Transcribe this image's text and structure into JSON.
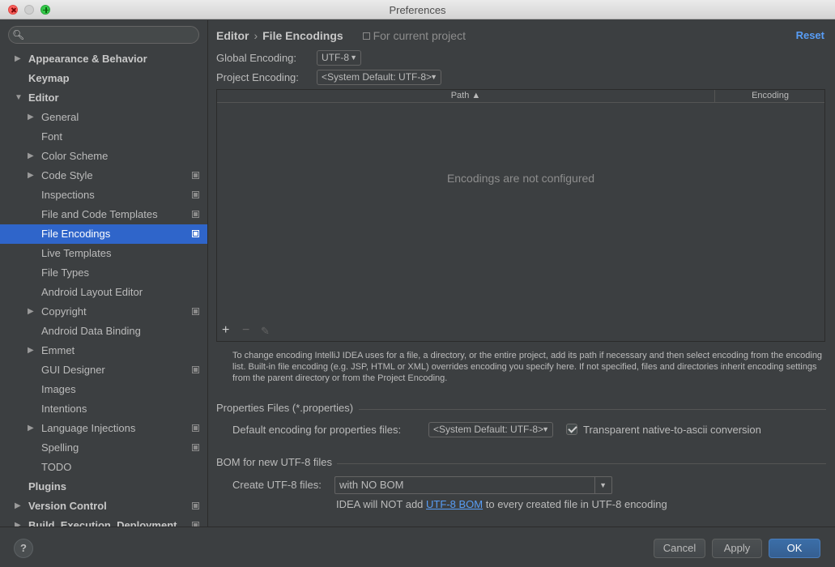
{
  "window": {
    "title": "Preferences"
  },
  "sidebar": {
    "search_placeholder": "",
    "items": [
      {
        "label": "Appearance & Behavior",
        "level": 0,
        "arrow": "▶",
        "bold": true
      },
      {
        "label": "Keymap",
        "level": 0,
        "arrow": "",
        "bold": true
      },
      {
        "label": "Editor",
        "level": 0,
        "arrow": "▼",
        "bold": true
      },
      {
        "label": "General",
        "level": 1,
        "arrow": "▶"
      },
      {
        "label": "Font",
        "level": 1,
        "arrow": ""
      },
      {
        "label": "Color Scheme",
        "level": 1,
        "arrow": "▶"
      },
      {
        "label": "Code Style",
        "level": 1,
        "arrow": "▶",
        "project": true
      },
      {
        "label": "Inspections",
        "level": 1,
        "arrow": "",
        "project": true
      },
      {
        "label": "File and Code Templates",
        "level": 1,
        "arrow": "",
        "project": true
      },
      {
        "label": "File Encodings",
        "level": 1,
        "arrow": "",
        "project": true,
        "selected": true
      },
      {
        "label": "Live Templates",
        "level": 1,
        "arrow": ""
      },
      {
        "label": "File Types",
        "level": 1,
        "arrow": ""
      },
      {
        "label": "Android Layout Editor",
        "level": 1,
        "arrow": ""
      },
      {
        "label": "Copyright",
        "level": 1,
        "arrow": "▶",
        "project": true
      },
      {
        "label": "Android Data Binding",
        "level": 1,
        "arrow": ""
      },
      {
        "label": "Emmet",
        "level": 1,
        "arrow": "▶"
      },
      {
        "label": "GUI Designer",
        "level": 1,
        "arrow": "",
        "project": true
      },
      {
        "label": "Images",
        "level": 1,
        "arrow": ""
      },
      {
        "label": "Intentions",
        "level": 1,
        "arrow": ""
      },
      {
        "label": "Language Injections",
        "level": 1,
        "arrow": "▶",
        "project": true
      },
      {
        "label": "Spelling",
        "level": 1,
        "arrow": "",
        "project": true
      },
      {
        "label": "TODO",
        "level": 1,
        "arrow": ""
      },
      {
        "label": "Plugins",
        "level": 0,
        "arrow": "",
        "bold": true
      },
      {
        "label": "Version Control",
        "level": 0,
        "arrow": "▶",
        "bold": true,
        "project": true
      },
      {
        "label": "Build, Execution, Deployment",
        "level": 0,
        "arrow": "▶",
        "bold": true,
        "project": true
      }
    ]
  },
  "breadcrumb": {
    "parent": "Editor",
    "separator": "›",
    "current": "File Encodings",
    "scope": "For current project"
  },
  "reset_label": "Reset",
  "global_encoding": {
    "label": "Global Encoding:",
    "value": "UTF-8"
  },
  "project_encoding": {
    "label": "Project Encoding:",
    "value": "<System Default: UTF-8>"
  },
  "table": {
    "columns": [
      "Path ▲",
      "Encoding"
    ],
    "empty_text": "Encodings are not configured",
    "toolbar": {
      "add": "+",
      "remove": "−",
      "edit": "✎"
    }
  },
  "help_text": "To change encoding IntelliJ IDEA uses for a file, a directory, or the entire project, add its path if necessary and then select encoding from the encoding list. Built-in file encoding (e.g. JSP, HTML or XML) overrides encoding you specify here. If not specified, files and directories inherit encoding settings from the parent directory or from the Project Encoding.",
  "properties_section": {
    "title": "Properties Files (*.properties)",
    "default_label": "Default encoding for properties files:",
    "default_value": "<System Default: UTF-8>",
    "transparent_label": "Transparent native-to-ascii conversion",
    "transparent_checked": true
  },
  "bom_section": {
    "title": "BOM for new UTF-8 files",
    "create_label": "Create UTF-8 files:",
    "create_value": "with NO BOM",
    "note_prefix": "IDEA will NOT add",
    "note_link": "UTF-8 BOM",
    "note_suffix": "to every created file in UTF-8 encoding"
  },
  "footer": {
    "help": "?",
    "cancel": "Cancel",
    "apply": "Apply",
    "ok": "OK"
  }
}
